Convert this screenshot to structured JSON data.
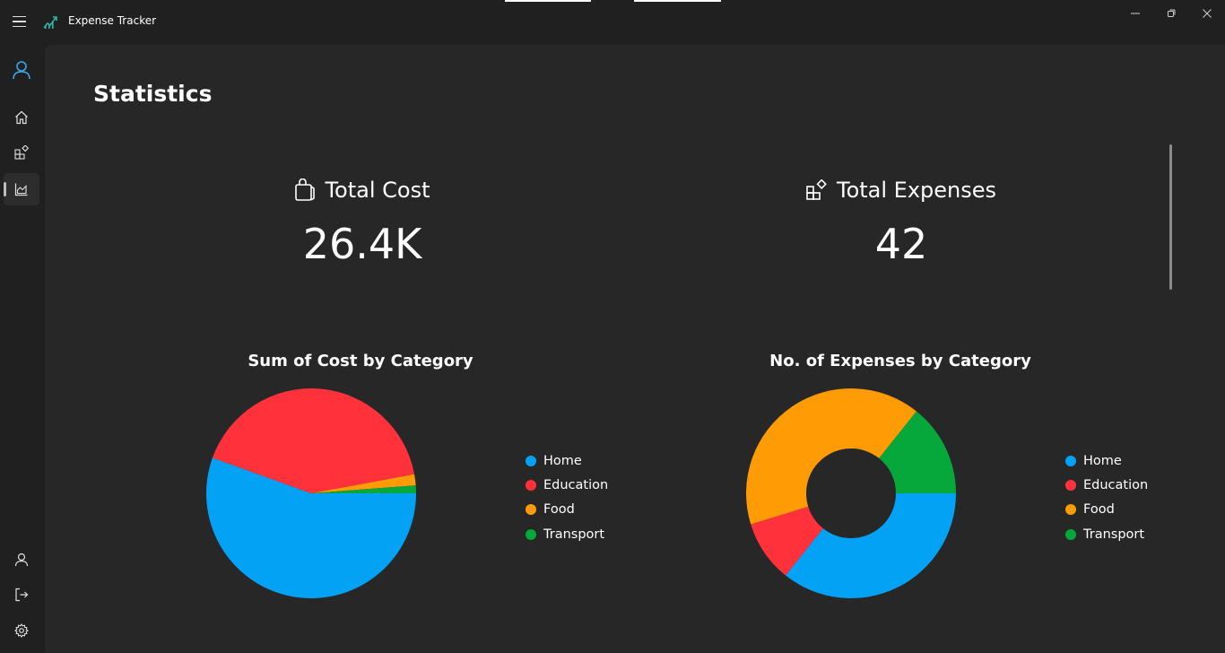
{
  "window": {
    "title": "Expense Tracker"
  },
  "page": {
    "title": "Statistics"
  },
  "stats": {
    "total_cost": {
      "label": "Total Cost",
      "value": "26.4K",
      "icon": "shopping-bag-icon"
    },
    "total_expenses": {
      "label": "Total Expenses",
      "value": "42",
      "icon": "apps-add-icon"
    }
  },
  "legend_colors": {
    "Home": "#03a2f5",
    "Education": "#ff323c",
    "Food": "#ff9b04",
    "Transport": "#07a83b"
  },
  "chart_data": [
    {
      "type": "pie",
      "title": "Sum of Cost by Category",
      "categories": [
        "Home",
        "Education",
        "Food",
        "Transport"
      ],
      "values": [
        55.5,
        41.6,
        1.7,
        1.2
      ],
      "legend": "right"
    },
    {
      "type": "pie",
      "title": "No. of Expenses by Category",
      "categories": [
        "Home",
        "Education",
        "Food",
        "Transport"
      ],
      "values": [
        15,
        4,
        17,
        6
      ],
      "donut": true,
      "legend": "right"
    }
  ]
}
